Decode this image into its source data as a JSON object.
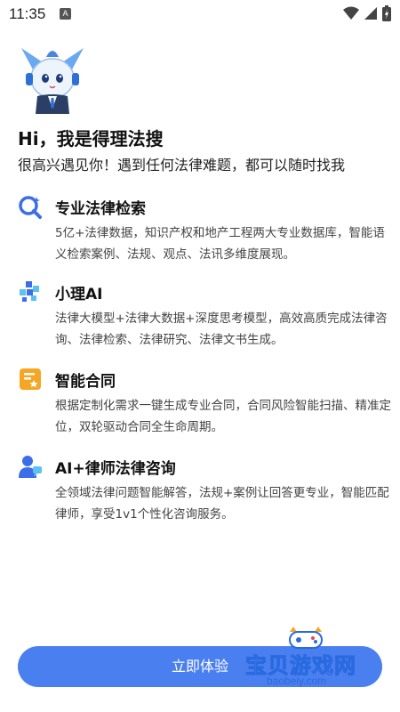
{
  "status_bar": {
    "time": "11:35",
    "notification_letter": "A"
  },
  "greeting": {
    "title": "Hi，我是得理法搜",
    "subtitle": "很高兴遇见你！遇到任何法律难题，都可以随时找我"
  },
  "features": [
    {
      "icon": "search-sparkle-icon",
      "title": "专业法律检索",
      "desc": "5亿+法律数据，知识产权和地产工程两大专业数据库，智能语义检索案例、法规、观点、法讯多维度展现。"
    },
    {
      "icon": "ai-blocks-icon",
      "title": "小理AI",
      "desc": "法律大模型+法律大数据+深度思考模型，高效高质完成法律咨询、法律检索、法律研究、法律文书生成。"
    },
    {
      "icon": "contract-icon",
      "title": "智能合同",
      "desc": "根据定制化需求一键生成专业合同，合同风险智能扫描、精准定位，双轮驱动合同全生命周期。"
    },
    {
      "icon": "lawyer-consult-icon",
      "title": "AI+律师法律咨询",
      "desc": "全领域法律问题智能解答，法规+案例让回答更专业，智能匹配律师，享受1v1个性化咨询服务。"
    }
  ],
  "cta": {
    "label": "立即体验"
  },
  "watermark": {
    "text": "宝贝游戏网",
    "url": "baobeiy.com"
  },
  "colors": {
    "accent": "#4a7ff0",
    "icon_blue": "#3c6ee8",
    "icon_orange": "#f5a623"
  }
}
